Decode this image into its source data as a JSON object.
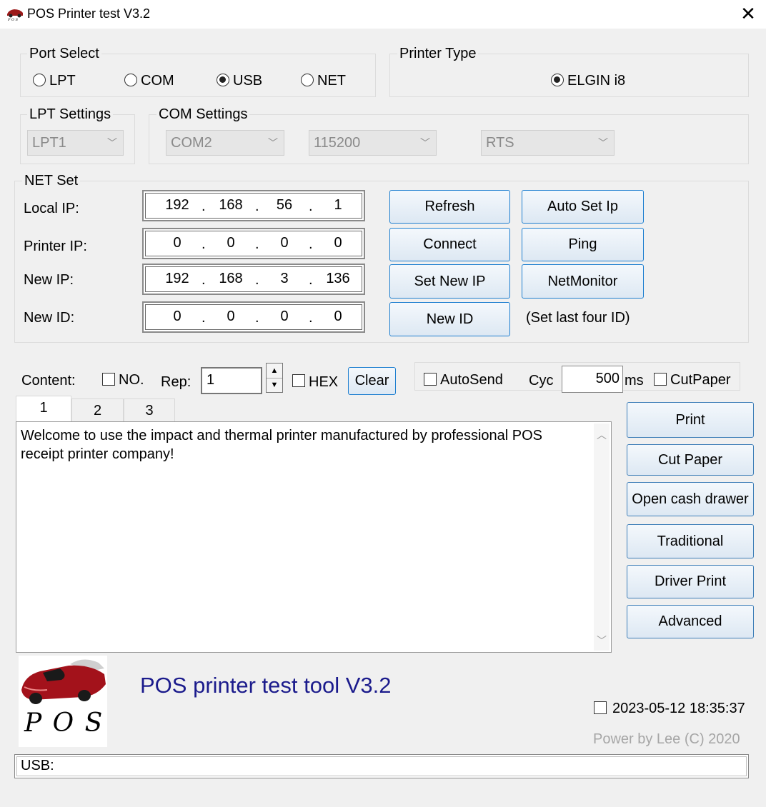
{
  "window": {
    "title": "POS Printer test V3.2",
    "close_glyph": "✕"
  },
  "port_select": {
    "legend": "Port Select",
    "options": [
      {
        "label": "LPT",
        "checked": false
      },
      {
        "label": "COM",
        "checked": false
      },
      {
        "label": "USB",
        "checked": true
      },
      {
        "label": "NET",
        "checked": false
      }
    ]
  },
  "printer_type": {
    "legend": "Printer Type",
    "option": {
      "label": "ELGIN i8",
      "checked": true
    }
  },
  "lpt_settings": {
    "legend": "LPT Settings",
    "port": "LPT1"
  },
  "com_settings": {
    "legend": "COM Settings",
    "port": "COM2",
    "baud": "115200",
    "flow": "RTS"
  },
  "net_set": {
    "legend": "NET Set",
    "rows": [
      {
        "label": "Local IP:",
        "octets": [
          "192",
          "168",
          "56",
          "1"
        ]
      },
      {
        "label": "Printer IP:",
        "octets": [
          "0",
          "0",
          "0",
          "0"
        ]
      },
      {
        "label": "New IP:",
        "octets": [
          "192",
          "168",
          "3",
          "136"
        ]
      },
      {
        "label": "New ID:",
        "octets": [
          "0",
          "0",
          "0",
          "0"
        ]
      }
    ],
    "buttons": {
      "refresh": "Refresh",
      "auto_set_ip": "Auto Set Ip",
      "connect": "Connect",
      "ping": "Ping",
      "set_new_ip": "Set New IP",
      "net_monitor": "NetMonitor",
      "new_id": "New ID"
    },
    "hint": "(Set last four ID)"
  },
  "content_bar": {
    "content_label": "Content:",
    "no_label": "NO.",
    "rep_label": "Rep:",
    "rep_value": "1",
    "hex_label": "HEX",
    "clear_label": "Clear",
    "autosend_label": "AutoSend",
    "cyc_label": "Cyc",
    "cyc_value": "500",
    "ms_label": "ms",
    "cutpaper_label": "CutPaper"
  },
  "tabs": [
    {
      "label": "1",
      "active": true
    },
    {
      "label": "2",
      "active": false
    },
    {
      "label": "3",
      "active": false
    }
  ],
  "editor": {
    "text": "Welcome to use the impact and thermal printer manufactured by professional POS receipt printer company!"
  },
  "side_buttons": {
    "print": "Print",
    "cut_paper": "Cut Paper",
    "open_cash_drawer": "Open cash drawer",
    "traditional": "Traditional",
    "driver_print": "Driver Print",
    "advanced": "Advanced"
  },
  "footer": {
    "logo_text": "P O S",
    "app_title": "POS printer test tool V3.2",
    "datetime": "2023-05-12 18:35:37",
    "credit": "Power by Lee (C) 2020",
    "status": "USB:",
    "title_color": "#1b1b8c"
  }
}
